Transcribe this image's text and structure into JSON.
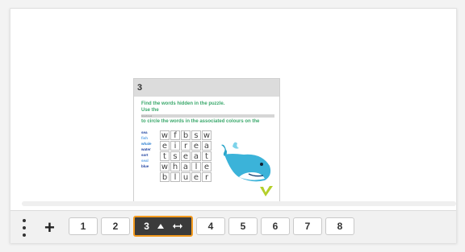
{
  "preview": {
    "page_number": "3",
    "instr1": "Find the words hidden in the puzzle.",
    "instr2": "Use the",
    "strip": "brush tool",
    "instr3": "to circle the words in the associated colours on the",
    "words": [
      {
        "text": "sea",
        "color": "#1a3e9e"
      },
      {
        "text": "fish",
        "color": "#5aa0e6"
      },
      {
        "text": "whale",
        "color": "#2d7fd1"
      },
      {
        "text": "water",
        "color": "#1a3e9e"
      },
      {
        "text": "sort",
        "color": "#1a3e9e"
      },
      {
        "text": "seal",
        "color": "#5aa0e6"
      },
      {
        "text": "blue",
        "color": "#1a3e9e"
      }
    ],
    "grid": [
      [
        "w",
        "f",
        "b",
        "s",
        "w"
      ],
      [
        "e",
        "i",
        "r",
        "e",
        "a"
      ],
      [
        "t",
        "s",
        "e",
        "a",
        "t"
      ],
      [
        "w",
        "h",
        "a",
        "l",
        "e"
      ],
      [
        "b",
        "l",
        "u",
        "e",
        "r"
      ]
    ]
  },
  "toolbar": {
    "menu_icon": "vertical-dots-icon",
    "add_label": "+",
    "pages": [
      "1",
      "2",
      "3",
      "4",
      "5",
      "6",
      "7",
      "8"
    ],
    "active_page": "3",
    "active_icons": [
      "caret-up-icon",
      "swap-horizontal-icon"
    ],
    "accent": "#f39a1e"
  }
}
